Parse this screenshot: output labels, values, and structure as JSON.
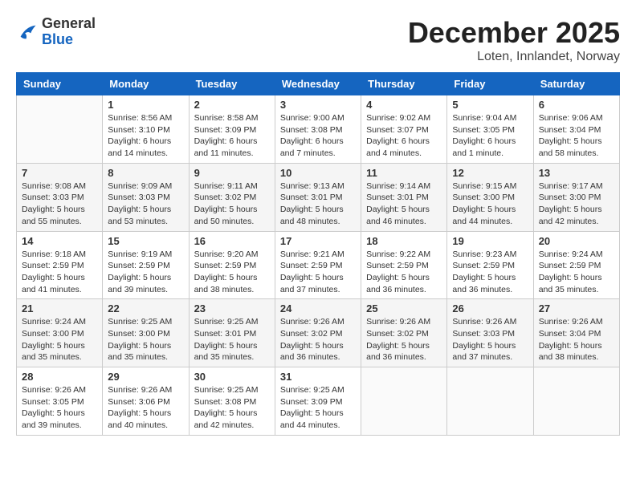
{
  "header": {
    "logo_general": "General",
    "logo_blue": "Blue",
    "month_title": "December 2025",
    "location": "Loten, Innlandet, Norway"
  },
  "weekdays": [
    "Sunday",
    "Monday",
    "Tuesday",
    "Wednesday",
    "Thursday",
    "Friday",
    "Saturday"
  ],
  "weeks": [
    [
      {
        "day": "",
        "info": ""
      },
      {
        "day": "1",
        "info": "Sunrise: 8:56 AM\nSunset: 3:10 PM\nDaylight: 6 hours\nand 14 minutes."
      },
      {
        "day": "2",
        "info": "Sunrise: 8:58 AM\nSunset: 3:09 PM\nDaylight: 6 hours\nand 11 minutes."
      },
      {
        "day": "3",
        "info": "Sunrise: 9:00 AM\nSunset: 3:08 PM\nDaylight: 6 hours\nand 7 minutes."
      },
      {
        "day": "4",
        "info": "Sunrise: 9:02 AM\nSunset: 3:07 PM\nDaylight: 6 hours\nand 4 minutes."
      },
      {
        "day": "5",
        "info": "Sunrise: 9:04 AM\nSunset: 3:05 PM\nDaylight: 6 hours\nand 1 minute."
      },
      {
        "day": "6",
        "info": "Sunrise: 9:06 AM\nSunset: 3:04 PM\nDaylight: 5 hours\nand 58 minutes."
      }
    ],
    [
      {
        "day": "7",
        "info": "Sunrise: 9:08 AM\nSunset: 3:03 PM\nDaylight: 5 hours\nand 55 minutes."
      },
      {
        "day": "8",
        "info": "Sunrise: 9:09 AM\nSunset: 3:03 PM\nDaylight: 5 hours\nand 53 minutes."
      },
      {
        "day": "9",
        "info": "Sunrise: 9:11 AM\nSunset: 3:02 PM\nDaylight: 5 hours\nand 50 minutes."
      },
      {
        "day": "10",
        "info": "Sunrise: 9:13 AM\nSunset: 3:01 PM\nDaylight: 5 hours\nand 48 minutes."
      },
      {
        "day": "11",
        "info": "Sunrise: 9:14 AM\nSunset: 3:01 PM\nDaylight: 5 hours\nand 46 minutes."
      },
      {
        "day": "12",
        "info": "Sunrise: 9:15 AM\nSunset: 3:00 PM\nDaylight: 5 hours\nand 44 minutes."
      },
      {
        "day": "13",
        "info": "Sunrise: 9:17 AM\nSunset: 3:00 PM\nDaylight: 5 hours\nand 42 minutes."
      }
    ],
    [
      {
        "day": "14",
        "info": "Sunrise: 9:18 AM\nSunset: 2:59 PM\nDaylight: 5 hours\nand 41 minutes."
      },
      {
        "day": "15",
        "info": "Sunrise: 9:19 AM\nSunset: 2:59 PM\nDaylight: 5 hours\nand 39 minutes."
      },
      {
        "day": "16",
        "info": "Sunrise: 9:20 AM\nSunset: 2:59 PM\nDaylight: 5 hours\nand 38 minutes."
      },
      {
        "day": "17",
        "info": "Sunrise: 9:21 AM\nSunset: 2:59 PM\nDaylight: 5 hours\nand 37 minutes."
      },
      {
        "day": "18",
        "info": "Sunrise: 9:22 AM\nSunset: 2:59 PM\nDaylight: 5 hours\nand 36 minutes."
      },
      {
        "day": "19",
        "info": "Sunrise: 9:23 AM\nSunset: 2:59 PM\nDaylight: 5 hours\nand 36 minutes."
      },
      {
        "day": "20",
        "info": "Sunrise: 9:24 AM\nSunset: 2:59 PM\nDaylight: 5 hours\nand 35 minutes."
      }
    ],
    [
      {
        "day": "21",
        "info": "Sunrise: 9:24 AM\nSunset: 3:00 PM\nDaylight: 5 hours\nand 35 minutes."
      },
      {
        "day": "22",
        "info": "Sunrise: 9:25 AM\nSunset: 3:00 PM\nDaylight: 5 hours\nand 35 minutes."
      },
      {
        "day": "23",
        "info": "Sunrise: 9:25 AM\nSunset: 3:01 PM\nDaylight: 5 hours\nand 35 minutes."
      },
      {
        "day": "24",
        "info": "Sunrise: 9:26 AM\nSunset: 3:02 PM\nDaylight: 5 hours\nand 36 minutes."
      },
      {
        "day": "25",
        "info": "Sunrise: 9:26 AM\nSunset: 3:02 PM\nDaylight: 5 hours\nand 36 minutes."
      },
      {
        "day": "26",
        "info": "Sunrise: 9:26 AM\nSunset: 3:03 PM\nDaylight: 5 hours\nand 37 minutes."
      },
      {
        "day": "27",
        "info": "Sunrise: 9:26 AM\nSunset: 3:04 PM\nDaylight: 5 hours\nand 38 minutes."
      }
    ],
    [
      {
        "day": "28",
        "info": "Sunrise: 9:26 AM\nSunset: 3:05 PM\nDaylight: 5 hours\nand 39 minutes."
      },
      {
        "day": "29",
        "info": "Sunrise: 9:26 AM\nSunset: 3:06 PM\nDaylight: 5 hours\nand 40 minutes."
      },
      {
        "day": "30",
        "info": "Sunrise: 9:25 AM\nSunset: 3:08 PM\nDaylight: 5 hours\nand 42 minutes."
      },
      {
        "day": "31",
        "info": "Sunrise: 9:25 AM\nSunset: 3:09 PM\nDaylight: 5 hours\nand 44 minutes."
      },
      {
        "day": "",
        "info": ""
      },
      {
        "day": "",
        "info": ""
      },
      {
        "day": "",
        "info": ""
      }
    ]
  ]
}
